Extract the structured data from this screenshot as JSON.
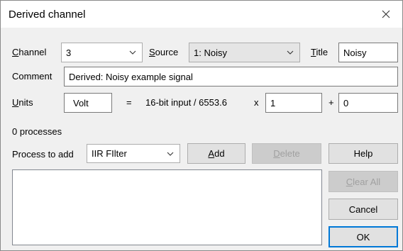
{
  "window": {
    "title": "Derived channel"
  },
  "channel": {
    "label_ul": "C",
    "label_rest": "hannel",
    "value": "3"
  },
  "source": {
    "label_ul": "S",
    "label_rest": "ource",
    "value": "1: Noisy"
  },
  "title_field": {
    "label_ul": "T",
    "label_rest": "itle",
    "value": "Noisy"
  },
  "comment": {
    "label": "Comment",
    "value": "Derived: Noisy example signal"
  },
  "units": {
    "label_ul": "U",
    "label_rest": "nits",
    "value": "Volt",
    "equals": "=",
    "formula": "16-bit input / 6553.6",
    "times": "x",
    "scale": "1",
    "plus": "+",
    "offset": "0"
  },
  "processes_count": "0 processes",
  "process_to_add": {
    "label": "Process to add",
    "value": "IIR FIlter"
  },
  "buttons": {
    "add_ul": "A",
    "add_rest": "dd",
    "delete_ul": "D",
    "delete_rest": "elete",
    "help": "Help",
    "clear_all_ul": "C",
    "clear_all_rest": "lear All",
    "cancel": "Cancel",
    "ok": "OK"
  }
}
